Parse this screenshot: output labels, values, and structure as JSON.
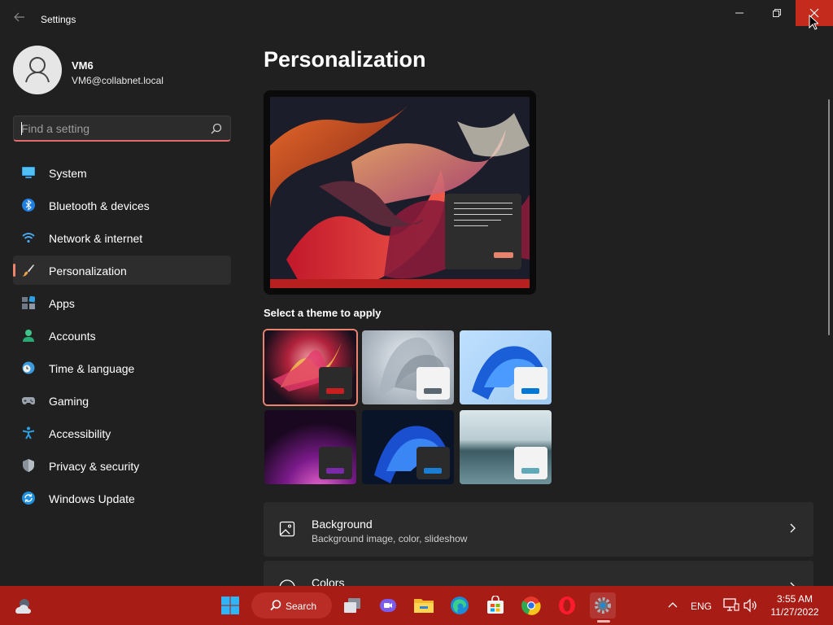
{
  "window": {
    "title": "Settings",
    "back_icon": "arrow-left-icon",
    "controls": {
      "minimize": "minimize-icon",
      "maximize": "restore-icon",
      "close": "close-icon",
      "close_color": "#c42b1c"
    }
  },
  "user": {
    "name": "VM6",
    "email": "VM6@collabnet.local"
  },
  "search": {
    "placeholder": "Find a setting",
    "value": ""
  },
  "sidebar": {
    "items": [
      {
        "label": "System",
        "icon": "monitor-icon",
        "active": false
      },
      {
        "label": "Bluetooth & devices",
        "icon": "bluetooth-icon",
        "active": false
      },
      {
        "label": "Network & internet",
        "icon": "wifi-icon",
        "active": false
      },
      {
        "label": "Personalization",
        "icon": "paintbrush-icon",
        "active": true
      },
      {
        "label": "Apps",
        "icon": "apps-icon",
        "active": false
      },
      {
        "label": "Accounts",
        "icon": "person-icon",
        "active": false
      },
      {
        "label": "Time & language",
        "icon": "clock-globe-icon",
        "active": false
      },
      {
        "label": "Gaming",
        "icon": "gamepad-icon",
        "active": false
      },
      {
        "label": "Accessibility",
        "icon": "accessibility-icon",
        "active": false
      },
      {
        "label": "Privacy & security",
        "icon": "shield-icon",
        "active": false
      },
      {
        "label": "Windows Update",
        "icon": "update-icon",
        "active": false
      }
    ]
  },
  "main": {
    "title": "Personalization",
    "themes_heading": "Select a theme to apply",
    "themes": [
      {
        "name": "glow-red",
        "selected": true,
        "accent": "#c81e1e"
      },
      {
        "name": "captured-motion",
        "selected": false,
        "accent": "#5b6770"
      },
      {
        "name": "windows-light",
        "selected": false,
        "accent": "#0078d4"
      },
      {
        "name": "flow-purple",
        "selected": false,
        "accent": "#7a2aa8"
      },
      {
        "name": "windows-dark",
        "selected": false,
        "accent": "#1a7fd4"
      },
      {
        "name": "sunrise-lake",
        "selected": false,
        "accent": "#5fa9b8"
      }
    ],
    "cards": [
      {
        "title": "Background",
        "subtitle": "Background image, color, slideshow",
        "icon": "image-icon"
      },
      {
        "title": "Colors",
        "subtitle": "",
        "icon": "palette-icon"
      }
    ]
  },
  "taskbar": {
    "color": "#a81c16",
    "search_label": "Search",
    "apps": [
      "windows-start-icon",
      "search-icon",
      "task-view-icon",
      "teams-chat-icon",
      "file-explorer-icon",
      "edge-icon",
      "store-icon",
      "chrome-icon",
      "opera-icon",
      "settings-icon"
    ],
    "language": "ENG",
    "time": "3:55 AM",
    "date": "11/27/2022"
  }
}
